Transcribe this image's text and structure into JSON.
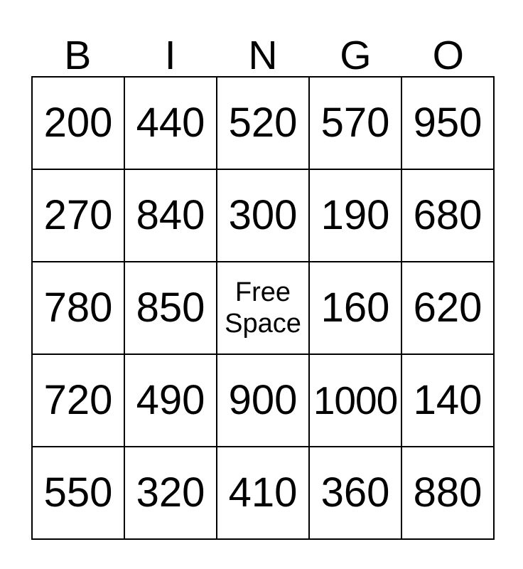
{
  "card": {
    "title": "BINGO",
    "columns": [
      "B",
      "I",
      "N",
      "G",
      "O"
    ],
    "free_space_label": "Free Space",
    "colors": {
      "background": "#ffffff",
      "text": "#000000",
      "border": "#000000"
    },
    "rows": [
      {
        "cells": [
          {
            "value": "200",
            "free": false
          },
          {
            "value": "440",
            "free": false
          },
          {
            "value": "520",
            "free": false
          },
          {
            "value": "570",
            "free": false
          },
          {
            "value": "950",
            "free": false
          }
        ]
      },
      {
        "cells": [
          {
            "value": "270",
            "free": false
          },
          {
            "value": "840",
            "free": false
          },
          {
            "value": "300",
            "free": false
          },
          {
            "value": "190",
            "free": false
          },
          {
            "value": "680",
            "free": false
          }
        ]
      },
      {
        "cells": [
          {
            "value": "780",
            "free": false
          },
          {
            "value": "850",
            "free": false
          },
          {
            "value": "Free Space",
            "free": true
          },
          {
            "value": "160",
            "free": false
          },
          {
            "value": "620",
            "free": false
          }
        ]
      },
      {
        "cells": [
          {
            "value": "720",
            "free": false
          },
          {
            "value": "490",
            "free": false
          },
          {
            "value": "900",
            "free": false
          },
          {
            "value": "1000",
            "free": false
          },
          {
            "value": "140",
            "free": false
          }
        ]
      },
      {
        "cells": [
          {
            "value": "550",
            "free": false
          },
          {
            "value": "320",
            "free": false
          },
          {
            "value": "410",
            "free": false
          },
          {
            "value": "360",
            "free": false
          },
          {
            "value": "880",
            "free": false
          }
        ]
      }
    ]
  }
}
